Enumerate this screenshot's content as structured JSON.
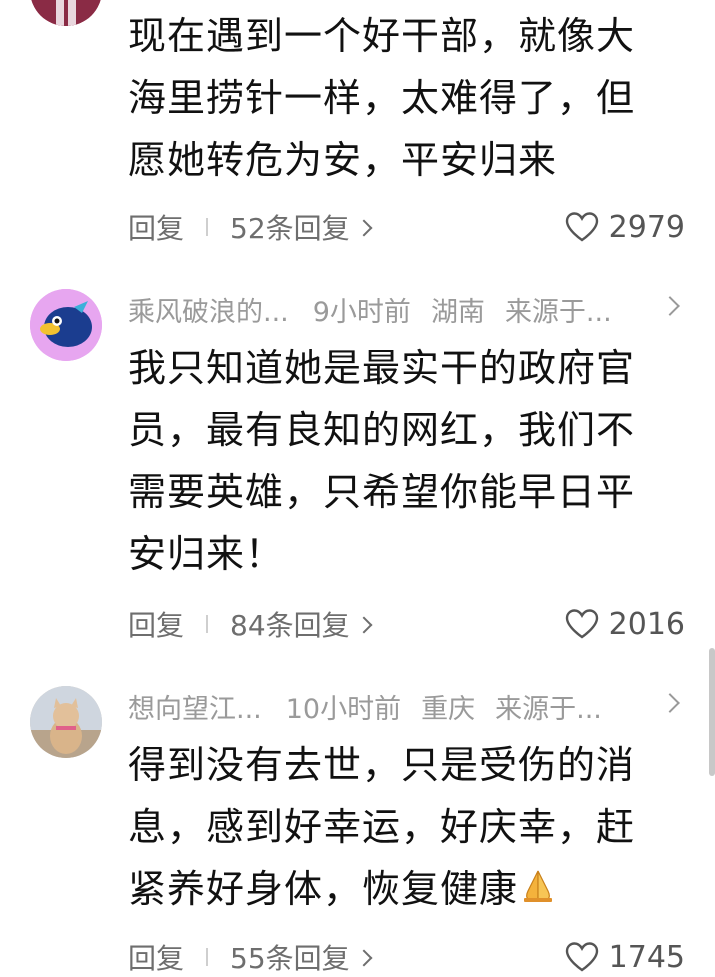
{
  "comments": [
    {
      "text_lines": [
        "现在遇到一个好干部，就像大",
        "海里捞针一样，太难得了，但",
        "愿她转危为安，平安归来"
      ],
      "reply_label": "回复",
      "replies_label": "52条回复",
      "likes": "2979"
    },
    {
      "user": "乘风破浪的...",
      "time": "9小时前",
      "location": "湖南",
      "source": "来源于...",
      "text_lines": [
        "我只知道她是最实干的政府官",
        "员，最有良知的网红，我们不",
        "需要英雄，只希望你能早日平",
        "安归来！"
      ],
      "reply_label": "回复",
      "replies_label": "84条回复",
      "likes": "2016"
    },
    {
      "user": "想向望江...",
      "time": "10小时前",
      "location": "重庆",
      "source": "来源于...",
      "text_lines": [
        "得到没有去世，只是受伤的消",
        "息，感到好幸运，好庆幸，赶",
        "紧养好身体，恢复健康"
      ],
      "reply_label": "回复",
      "replies_label": "55条回复",
      "likes": "1745"
    }
  ],
  "icons": {
    "heart": "heart-outline-icon",
    "chevron": "chevron-right-icon",
    "praying_hands": "praying-hands-emoji"
  },
  "colors": {
    "meta_text": "#9a9a9a",
    "action_text": "#6e6e6e",
    "body_text": "#111111",
    "avatar_purple": "#e7a6f0"
  }
}
